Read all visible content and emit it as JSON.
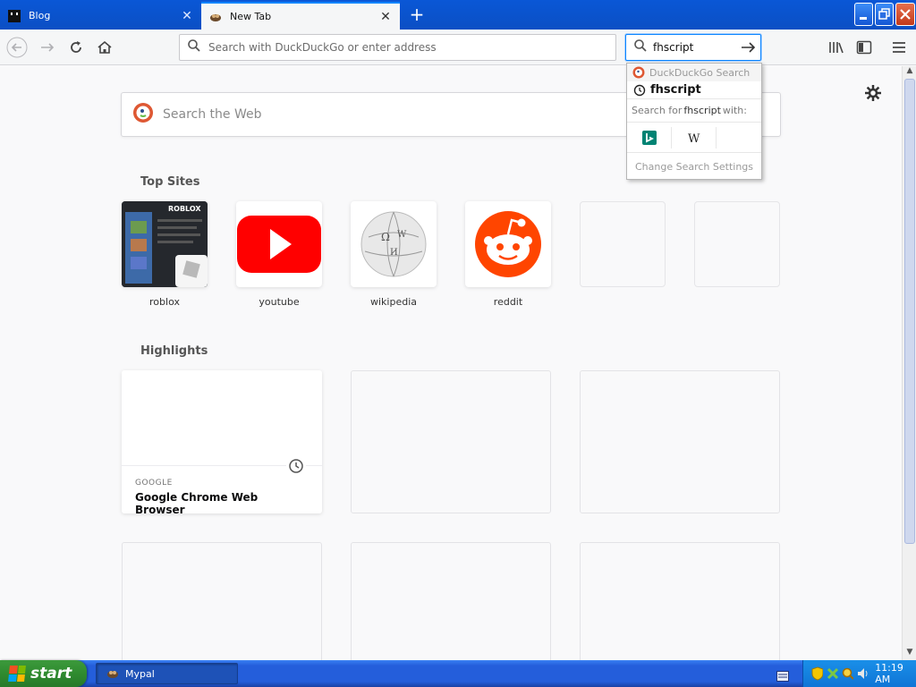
{
  "tabs": [
    {
      "label": "Blog",
      "active": false
    },
    {
      "label": "New Tab",
      "active": true
    }
  ],
  "window_controls": {
    "minimize": "minimize-icon",
    "maximize": "maximize-icon",
    "close": "close-icon"
  },
  "navbar": {
    "url_placeholder": "Search with DuckDuckGo or enter address",
    "search_value": "fhscript"
  },
  "search_popup": {
    "engine_header": "DuckDuckGo Search",
    "suggestion": "fhscript",
    "search_for_prefix": "Search for",
    "search_for_term": "fhscript",
    "search_for_suffix": "with:",
    "engines": [
      "bing-icon",
      "wikipedia-icon"
    ],
    "settings_label": "Change Search Settings"
  },
  "newtab": {
    "search_placeholder": "Search the Web",
    "top_sites_title": "Top Sites",
    "top_sites": [
      {
        "label": "roblox"
      },
      {
        "label": "youtube"
      },
      {
        "label": "wikipedia"
      },
      {
        "label": "reddit"
      },
      {
        "label": ""
      },
      {
        "label": ""
      }
    ],
    "highlights_title": "Highlights",
    "highlight_card": {
      "host": "GOOGLE",
      "title": "Google Chrome Web Browser"
    }
  },
  "taskbar": {
    "start_label": "start",
    "task_label": "Mypal",
    "clock": "11:19 AM"
  },
  "colors": {
    "titlebar": "#0b4fc4",
    "accent": "#0a84ff",
    "youtube_red": "#ff0000",
    "reddit_orange": "#ff4500",
    "ddg_orange": "#de5833",
    "start_green": "#2f8b2f"
  }
}
